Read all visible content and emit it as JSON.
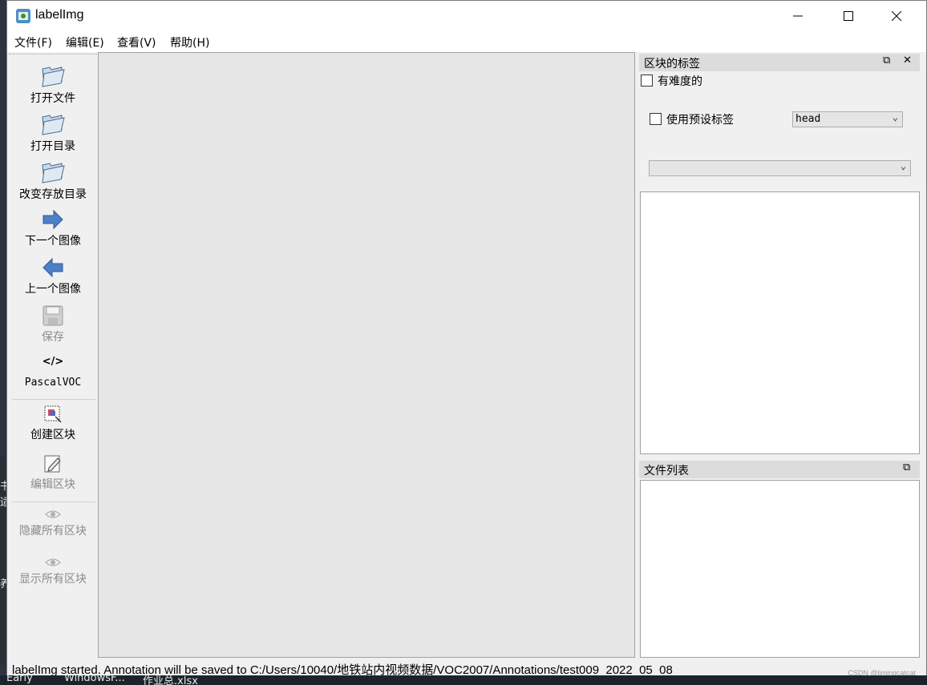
{
  "window": {
    "title": "labelImg"
  },
  "menu": [
    "文件(F)",
    "编辑(E)",
    "查看(V)",
    "帮助(H)"
  ],
  "toolbar": {
    "open_file": "打开文件",
    "open_dir": "打开目录",
    "change_save_dir": "改变存放目录",
    "next_image": "下一个图像",
    "prev_image": "上一个图像",
    "save": "保存",
    "format_icon_text": "</>",
    "format": "PascalVOC",
    "create_box": "创建区块",
    "edit_box": "编辑区块",
    "hide_all": "隐藏所有区块",
    "show_all": "显示所有区块"
  },
  "label_dock": {
    "title": "区块的标签",
    "difficult_label": "有难度的",
    "use_default_label": "使用预设标签",
    "default_label_value": "head",
    "second_combo_value": ""
  },
  "file_dock": {
    "title": "文件列表"
  },
  "status": "labelImg started. Annotation will be saved to C:/Users/10040/地铁站内视频数据/VOC2007/Annotations/test009_2022_05_08",
  "watermark": "CSDN @limingcatcat",
  "taskbar": [
    "Early",
    "WindowsF...",
    "作业总.xlsx"
  ],
  "desktop_fragments": [
    "书",
    "适",
    "养"
  ]
}
